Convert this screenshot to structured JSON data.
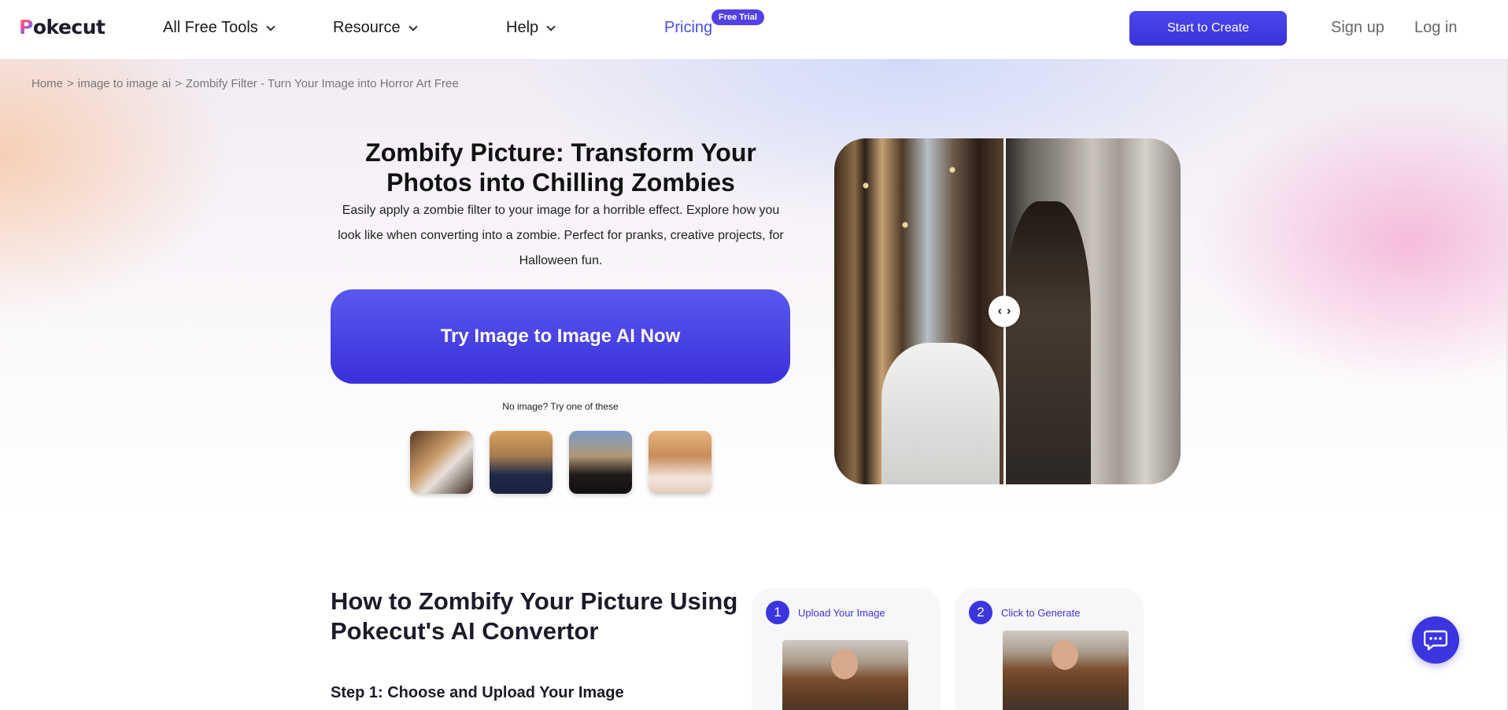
{
  "header": {
    "logo_text": "okecut",
    "logo_letter": "P",
    "nav": {
      "all_tools": "All Free Tools",
      "resource": "Resource",
      "help": "Help",
      "pricing": "Pricing",
      "free_trial_badge": "Free Trial"
    },
    "start_button": "Start to Create",
    "signup": "Sign up",
    "login": "Log in"
  },
  "breadcrumb": {
    "home": "Home",
    "sep": ">",
    "category": "image to image ai",
    "current": "Zombify Filter - Turn Your Image into Horror Art Free"
  },
  "hero": {
    "title": "Zombify Picture: Transform Your Photos into Chilling Zombies",
    "description": "Easily apply a zombie filter to your image for a horrible effect. Explore how you look like when converting into a zombie. Perfect for pranks, creative projects, for Halloween fun.",
    "cta": "Try Image to Image AI Now",
    "no_image_hint": "No image? Try one of these",
    "handle_left": "‹",
    "handle_right": "›"
  },
  "howto": {
    "title": "How to Zombify Your Picture Using Pokecut's AI Convertor",
    "step1_heading": "Step 1: Choose and Upload Your Image",
    "cards": [
      {
        "number": "1",
        "label": "Upload Your Image"
      },
      {
        "number": "2",
        "label": "Click to Generate"
      }
    ]
  },
  "colors": {
    "accent": "#3b35e0",
    "pricing": "#4a4fe0"
  }
}
